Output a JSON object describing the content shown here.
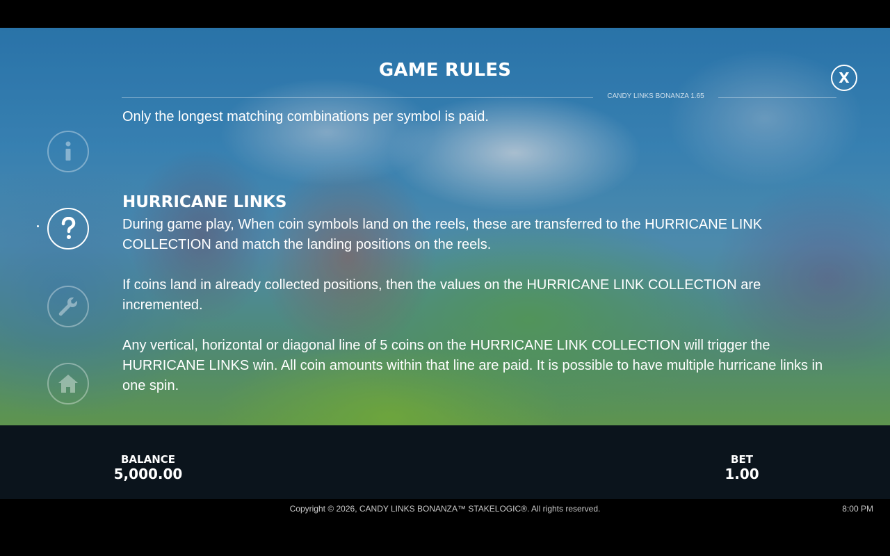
{
  "header": {
    "title": "GAME RULES",
    "version": "CANDY LINKS BONANZA 1.65",
    "close_label": "X"
  },
  "sidebar": {
    "items": [
      {
        "name": "info",
        "icon": "info-icon",
        "active": false
      },
      {
        "name": "help",
        "icon": "question-icon",
        "active": true
      },
      {
        "name": "settings",
        "icon": "wrench-icon",
        "active": false
      },
      {
        "name": "home",
        "icon": "home-icon",
        "active": false
      }
    ]
  },
  "content": {
    "intro": "Only the longest matching combinations per symbol is paid.",
    "section_title": "HURRICANE LINKS",
    "paragraphs": [
      "During game play, When coin symbols land on the reels, these are transferred to the HURRICANE LINK COLLECTION and match the landing positions on the reels.",
      "If coins land in already collected positions, then the values on the HURRICANE LINK COLLECTION are incremented.",
      "Any vertical, horizontal or diagonal line of 5 coins on the HURRICANE LINK COLLECTION will trigger the HURRICANE LINKS win. All coin amounts within that line are paid. It is possible to have multiple hurricane links in one spin."
    ]
  },
  "footer": {
    "balance_label": "BALANCE",
    "balance_value": "5,000.00",
    "bet_label": "BET",
    "bet_value": "1.00",
    "copyright": "Copyright © 2026, CANDY LINKS BONANZA™ STAKELOGIC®. All rights reserved.",
    "clock": "8:00 PM"
  },
  "colors": {
    "text": "#ffffff",
    "bottom_bar": "#0c161e",
    "sky": "#2e7fb8",
    "grass": "#6ea84a"
  }
}
